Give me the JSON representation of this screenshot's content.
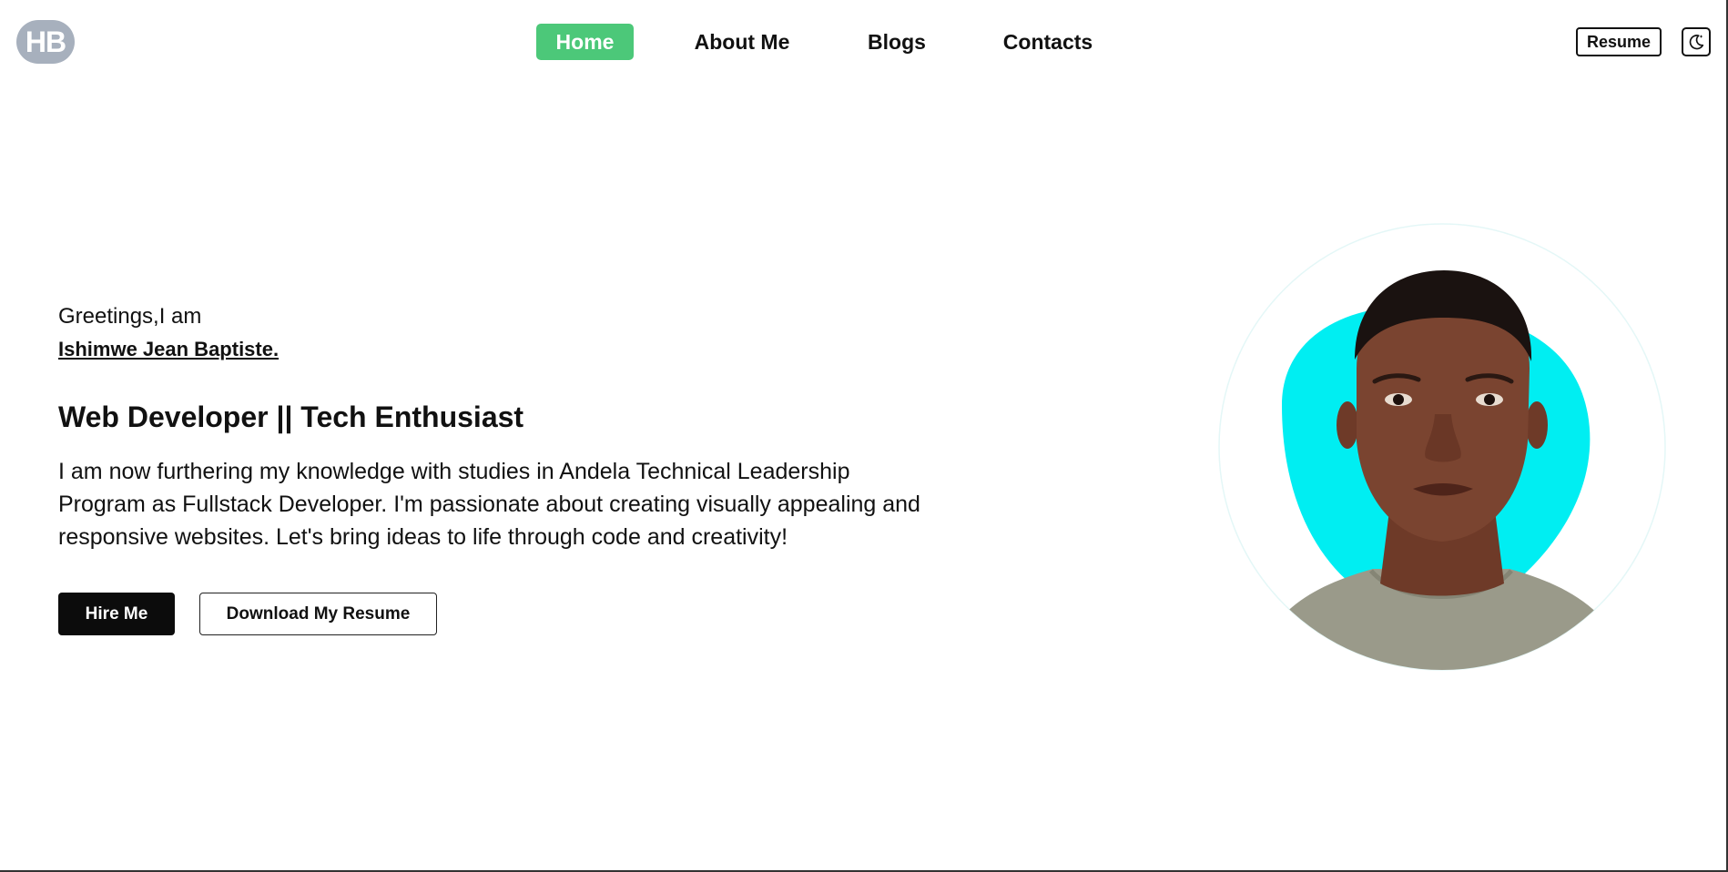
{
  "header": {
    "logo_text": "HB",
    "nav": [
      {
        "label": "Home",
        "active": true
      },
      {
        "label": "About Me",
        "active": false
      },
      {
        "label": "Blogs",
        "active": false
      },
      {
        "label": "Contacts",
        "active": false
      }
    ],
    "resume_label": "Resume",
    "theme_toggle_icon": "moon-icon"
  },
  "hero": {
    "greeting": "Greetings,I am",
    "name": "Ishimwe Jean Baptiste.",
    "role": "Web Developer || Tech Enthusiast",
    "intro_lines": [
      "I am now furthering my knowledge with studies in Andela Technical Leadership",
      "Program as Fullstack Developer. I'm passionate about creating visually appealing and",
      "responsive websites. Let's bring ideas to life through code and creativity!"
    ],
    "hire_label": "Hire Me",
    "download_label": "Download My Resume",
    "portrait_icon": "profile-photo"
  },
  "colors": {
    "accent_green": "#4cc879",
    "logo_gray": "#a7b0bd",
    "blob_cyan": "#00eef2",
    "shirt": "#9a9a8a",
    "skin": "#7a4430"
  }
}
